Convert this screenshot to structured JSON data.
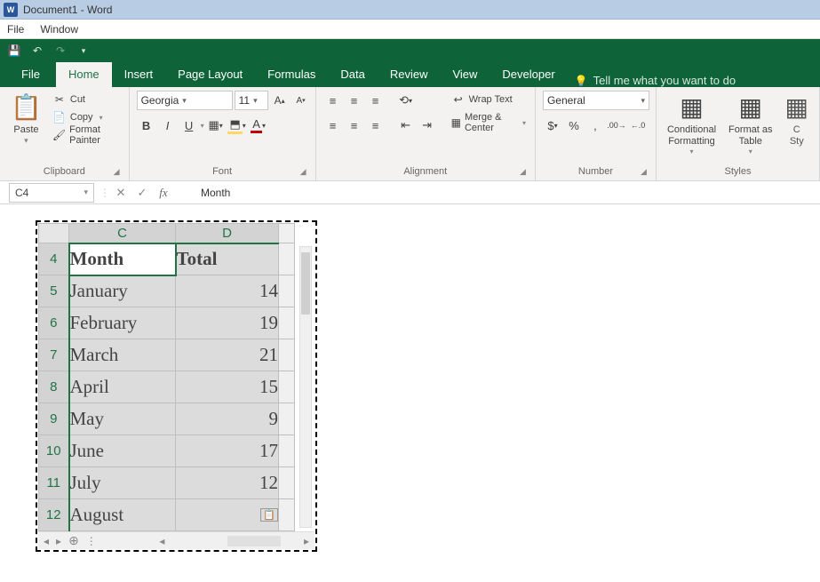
{
  "window": {
    "title": "Document1 - Word",
    "app_icon_text": "W"
  },
  "menubar": {
    "file": "File",
    "window": "Window"
  },
  "ribbon": {
    "tabs": {
      "file": "File",
      "home": "Home",
      "insert": "Insert",
      "page_layout": "Page Layout",
      "formulas": "Formulas",
      "data": "Data",
      "review": "Review",
      "view": "View",
      "developer": "Developer"
    },
    "tell_me": "Tell me what you want to do",
    "clipboard": {
      "paste": "Paste",
      "cut": "Cut",
      "copy": "Copy",
      "format_painter": "Format Painter",
      "label": "Clipboard"
    },
    "font": {
      "name": "Georgia",
      "size": "11",
      "bold": "B",
      "italic": "I",
      "underline": "U",
      "label": "Font"
    },
    "alignment": {
      "wrap_text": "Wrap Text",
      "merge_center": "Merge & Center",
      "label": "Alignment"
    },
    "number": {
      "format": "General",
      "label": "Number"
    },
    "styles": {
      "conditional": "Conditional\nFormatting",
      "format_as_table": "Format as\nTable",
      "cell_styles_short": "C\nSty",
      "label": "Styles"
    }
  },
  "formula_bar": {
    "cell_ref": "C4",
    "value": "Month"
  },
  "sheet": {
    "columns": [
      "C",
      "D"
    ],
    "rows": [
      {
        "n": "4",
        "month": "Month",
        "total": "Total",
        "header": true
      },
      {
        "n": "5",
        "month": "January",
        "total": "14"
      },
      {
        "n": "6",
        "month": "February",
        "total": "19"
      },
      {
        "n": "7",
        "month": "March",
        "total": "21"
      },
      {
        "n": "8",
        "month": "April",
        "total": "15"
      },
      {
        "n": "9",
        "month": "May",
        "total": "9"
      },
      {
        "n": "10",
        "month": "June",
        "total": "17"
      },
      {
        "n": "11",
        "month": "July",
        "total": "12"
      },
      {
        "n": "12",
        "month": "August",
        "total": ""
      }
    ]
  }
}
